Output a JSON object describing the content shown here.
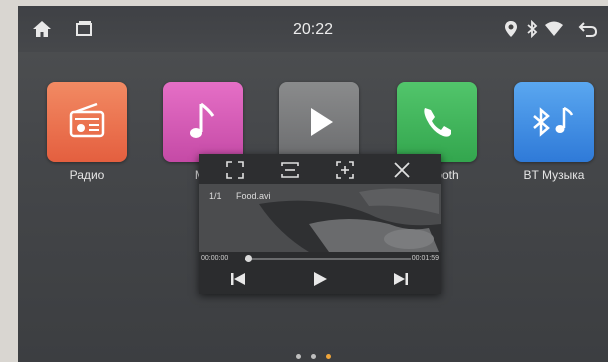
{
  "statusbar": {
    "clock": "20:22",
    "icons": [
      "home-icon",
      "recent-apps-icon",
      "location-pin-icon",
      "bluetooth-icon",
      "wifi-icon",
      "back-icon"
    ]
  },
  "apps": [
    {
      "label": "Радио",
      "icon": "radio-icon",
      "color": "#e96b4a"
    },
    {
      "label": "Му",
      "icon": "music-note-icon",
      "color": "#d45cb6"
    },
    {
      "label": "",
      "icon": "play-icon",
      "color": "#7b7c7e"
    },
    {
      "label": "ooth",
      "icon": "phone-icon",
      "color": "#40b55a"
    },
    {
      "label": "BT Музыка",
      "icon": "bluetooth-music-icon",
      "color": "#3f8fe3"
    }
  ],
  "player": {
    "toolbar_icons": [
      "fullscreen-icon",
      "fit-screen-icon",
      "zoom-icon",
      "close-icon"
    ],
    "track_index": "1/1",
    "file_name": "Food.avi",
    "time_current": "00:00:00",
    "time_total": "00:01:59",
    "progress_fraction": 0.02
  },
  "pager": {
    "pages": 3,
    "active": 2
  }
}
